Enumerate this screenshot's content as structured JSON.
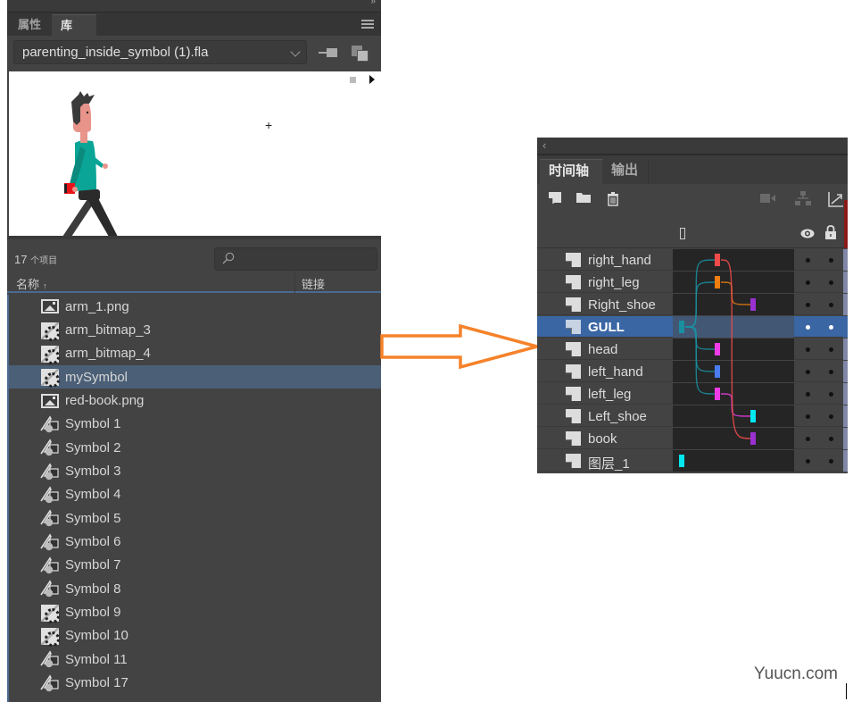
{
  "library_panel": {
    "tabs": [
      {
        "label": "属性",
        "active": false
      },
      {
        "label": "库",
        "active": true
      }
    ],
    "document_select": {
      "value": "parenting_inside_symbol (1).fla"
    },
    "icons": {
      "menu": "panel-menu-icon",
      "pin": "pin-icon",
      "new_library": "new-library-panel-icon",
      "stop": "stop-icon",
      "play": "play-icon",
      "search": "search-icon"
    },
    "item_count": {
      "number": "17",
      "unit": "个项目"
    },
    "search": {
      "value": "",
      "placeholder": ""
    },
    "columns": {
      "name": "名称",
      "sort_indicator": "↑",
      "linkage": "链接"
    },
    "items": [
      {
        "label": "arm_1.png",
        "type": "bitmap",
        "selected": false
      },
      {
        "label": "arm_bitmap_3",
        "type": "movieclip",
        "selected": false
      },
      {
        "label": "arm_bitmap_4",
        "type": "movieclip",
        "selected": false
      },
      {
        "label": "mySymbol",
        "type": "movieclip",
        "selected": true
      },
      {
        "label": "red-book.png",
        "type": "bitmap",
        "selected": false
      },
      {
        "label": "Symbol 1",
        "type": "graphic",
        "selected": false
      },
      {
        "label": "Symbol 2",
        "type": "graphic",
        "selected": false
      },
      {
        "label": "Symbol 3",
        "type": "graphic",
        "selected": false
      },
      {
        "label": "Symbol 4",
        "type": "graphic",
        "selected": false
      },
      {
        "label": "Symbol 5",
        "type": "graphic",
        "selected": false
      },
      {
        "label": "Symbol 6",
        "type": "graphic",
        "selected": false
      },
      {
        "label": "Symbol 7",
        "type": "graphic",
        "selected": false
      },
      {
        "label": "Symbol 8",
        "type": "graphic",
        "selected": false
      },
      {
        "label": "Symbol 9",
        "type": "movieclip",
        "selected": false
      },
      {
        "label": "Symbol 10",
        "type": "movieclip",
        "selected": false
      },
      {
        "label": "Symbol 11",
        "type": "graphic",
        "selected": false
      },
      {
        "label": "Symbol 17",
        "type": "graphic",
        "selected": false
      }
    ],
    "preview": {
      "registration_mark": "+"
    }
  },
  "arrow": {
    "color": "#f5822a",
    "direction": "right"
  },
  "timeline_panel": {
    "back_glyph": "‹",
    "tabs": [
      {
        "label": "时间轴",
        "active": true
      },
      {
        "label": "输出",
        "active": false
      }
    ],
    "toolbar_icons": [
      "new-layer-icon",
      "new-folder-icon",
      "delete-icon",
      "camera-icon",
      "layer-parenting-icon",
      "graph-icon"
    ],
    "header_icons": {
      "visibility": "eye-icon",
      "lock": "lock-icon"
    },
    "layers": [
      {
        "name": "right_hand",
        "selected": false,
        "keyframe_color": "#f04b4b",
        "depth": 1,
        "parent": "GULL"
      },
      {
        "name": "right_leg",
        "selected": false,
        "keyframe_color": "#f07d10",
        "depth": 1,
        "parent": "GULL"
      },
      {
        "name": "Right_shoe",
        "selected": false,
        "keyframe_color": "#9b30d0",
        "depth": 2,
        "parent": "right_leg"
      },
      {
        "name": "GULL",
        "selected": true,
        "keyframe_color": "#1a8fa0",
        "depth": 0,
        "parent": null
      },
      {
        "name": "head",
        "selected": false,
        "keyframe_color": "#f03ce8",
        "depth": 1,
        "parent": "GULL"
      },
      {
        "name": "left_hand",
        "selected": false,
        "keyframe_color": "#4a7cf0",
        "depth": 1,
        "parent": "GULL"
      },
      {
        "name": "left_leg",
        "selected": false,
        "keyframe_color": "#f03ce8",
        "depth": 1,
        "parent": "GULL"
      },
      {
        "name": "Left_shoe",
        "selected": false,
        "keyframe_color": "#00e8f0",
        "depth": 2,
        "parent": "left_leg"
      },
      {
        "name": "book",
        "selected": false,
        "keyframe_color": "#9b30d0",
        "depth": 2,
        "parent": "right_hand"
      },
      {
        "name": "图层_1",
        "selected": false,
        "keyframe_color": "#00e8f0",
        "depth": 0,
        "parent": null
      }
    ]
  },
  "watermark": "Yuucn.com"
}
